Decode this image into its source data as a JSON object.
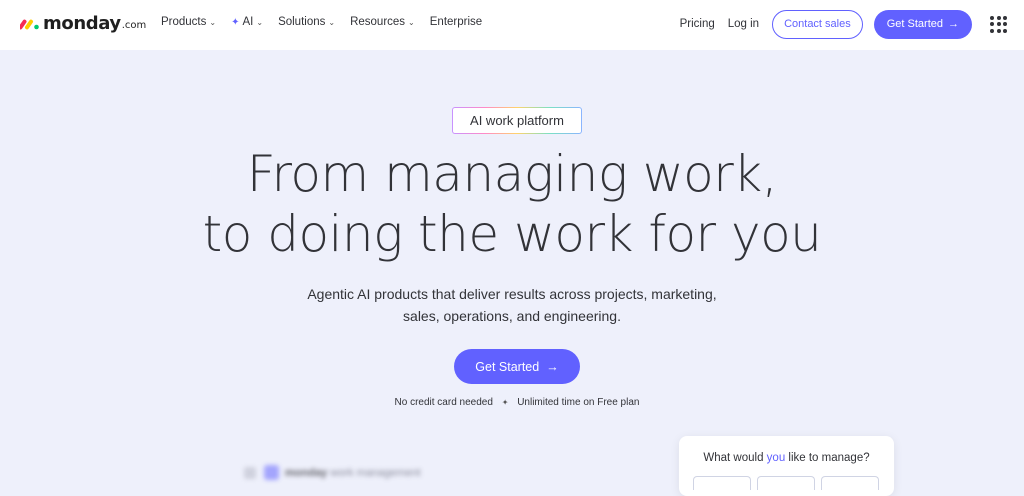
{
  "brand": {
    "name": "monday",
    "suffix": ".com"
  },
  "nav": {
    "menu": [
      {
        "label": "Products",
        "dropdown": true
      },
      {
        "label": "AI",
        "dropdown": true,
        "icon": "sparkle-icon"
      },
      {
        "label": "Solutions",
        "dropdown": true
      },
      {
        "label": "Resources",
        "dropdown": true
      },
      {
        "label": "Enterprise",
        "dropdown": false
      }
    ],
    "pricing": "Pricing",
    "login": "Log in",
    "contact_sales": "Contact sales",
    "get_started": "Get Started"
  },
  "hero": {
    "tag": "AI work platform",
    "headline_line1": "From managing work,",
    "headline_line2": "to doing the work for you",
    "subheadline_line1": "Agentic AI products that deliver results across projects, marketing,",
    "subheadline_line2": "sales, operations, and engineering.",
    "cta": "Get Started",
    "note_part1": "No credit card needed",
    "note_part2": "Unlimited time on Free plan",
    "preview_brand": "monday",
    "preview_label": "work management"
  },
  "manage_card": {
    "title_before": "What would ",
    "title_highlight": "you",
    "title_after": " like to manage?"
  },
  "colors": {
    "accent": "#6161ff",
    "hero_bg": "#eef0fb",
    "text": "#323338"
  }
}
